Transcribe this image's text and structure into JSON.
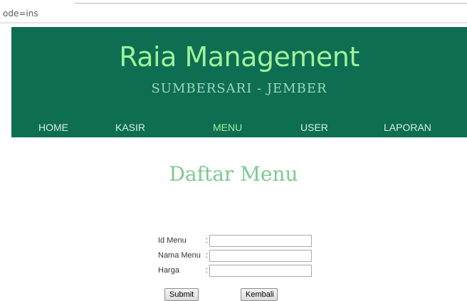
{
  "browser": {
    "url_fragment": "ode=ins"
  },
  "header": {
    "title": "Raia Management",
    "subtitle": "SUMBERSARI - JEMBER"
  },
  "nav": {
    "items": [
      {
        "label": "HOME",
        "active": false
      },
      {
        "label": "KASIR",
        "active": false
      },
      {
        "label": "MENU",
        "active": true
      },
      {
        "label": "USER",
        "active": false
      },
      {
        "label": "LAPORAN",
        "active": false
      }
    ]
  },
  "main": {
    "heading": "Daftar Menu"
  },
  "form": {
    "fields": [
      {
        "label": "Id Menu",
        "colon": ":",
        "value": ""
      },
      {
        "label": "Nama Menu",
        "colon": ":",
        "value": ""
      },
      {
        "label": "Harga",
        "colon": ":",
        "value": ""
      }
    ],
    "submit_label": "Submit",
    "back_label": "Kembali"
  },
  "colors": {
    "header_bg": "#0d6e52",
    "title": "#9ef29a",
    "nav_active": "#9ef29a",
    "heading": "#7fc88f"
  }
}
